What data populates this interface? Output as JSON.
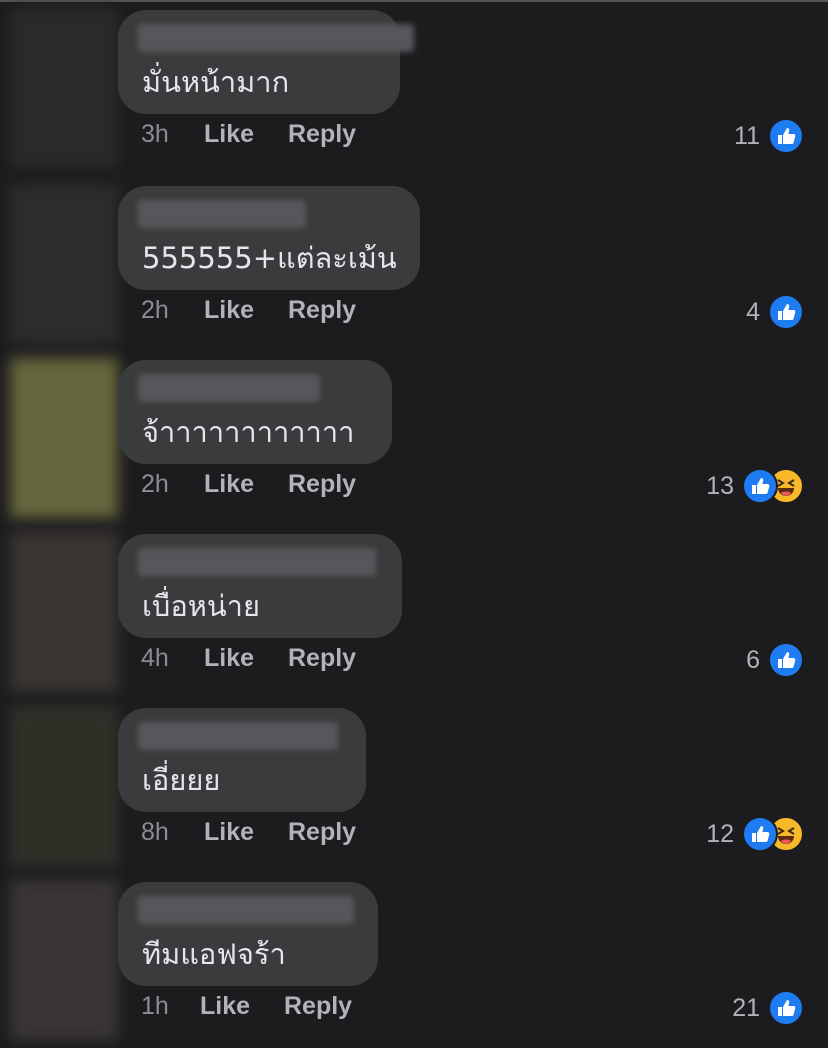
{
  "comments": [
    {
      "text": "มั่นหน้ามาก",
      "time": "3h",
      "like_label": "Like",
      "reply_label": "Reply",
      "reaction_count": "11",
      "reactions": [
        "like-icon"
      ],
      "avatar_color": "#2a2b2d"
    },
    {
      "text": "555555+แต่ละเม้น",
      "time": "2h",
      "like_label": "Like",
      "reply_label": "Reply",
      "reaction_count": "4",
      "reactions": [
        "like-icon"
      ],
      "avatar_color": "#2c2d2f"
    },
    {
      "text": "จ้าาาาาาาาาาาา",
      "time": "2h",
      "like_label": "Like",
      "reply_label": "Reply",
      "reaction_count": "13",
      "reactions": [
        "like-icon",
        "haha-icon"
      ],
      "avatar_color": "#6b6a3e"
    },
    {
      "text": "เบื่อหน่าย",
      "time": "4h",
      "like_label": "Like",
      "reply_label": "Reply",
      "reaction_count": "6",
      "reactions": [
        "like-icon"
      ],
      "avatar_color": "#3c3634"
    },
    {
      "text": "เอี่ยยย",
      "time": "8h",
      "like_label": "Like",
      "reply_label": "Reply",
      "reaction_count": "12",
      "reactions": [
        "like-icon",
        "haha-icon"
      ],
      "avatar_color": "#303229"
    },
    {
      "text": "ทีมแอฟจร้า",
      "time": "1h",
      "like_label": "Like",
      "reply_label": "Reply",
      "reaction_count": "21",
      "reactions": [
        "like-icon"
      ],
      "avatar_color": "#3b3738"
    }
  ],
  "colors": {
    "background": "#1c1c1e",
    "bubble": "#3a3b3c",
    "like_blue": "#1f7bf2",
    "haha_yellow": "#f7b928"
  }
}
